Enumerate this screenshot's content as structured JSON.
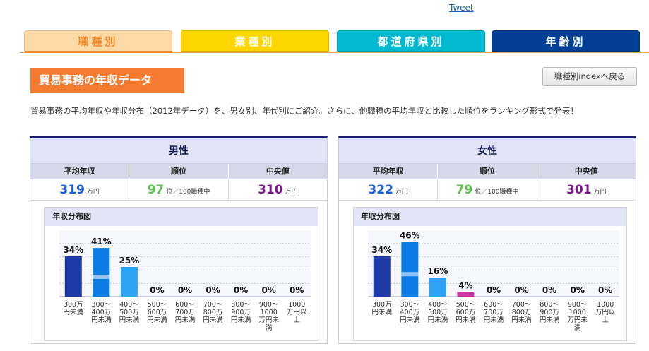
{
  "tweet": "Tweet",
  "tabs": {
    "job": "職種別",
    "industry": "業種別",
    "prefecture": "都道府県別",
    "age": "年齢別"
  },
  "heading": "貿易事務の年収データ",
  "index_button": "職種別indexへ戻る",
  "intro": "貿易事務の平均年収や年収分布（2012年データ）を、男女別、年代別にご紹介。さらに、他職種の平均年収と比較した順位をランキング形式で発表！",
  "stat_headers": {
    "average": "平均年収",
    "rank": "順位",
    "median": "中央値"
  },
  "male": {
    "title": "男性",
    "average": "319",
    "average_unit": "万円",
    "rank": "97",
    "rank_unit": "位／100職種中",
    "median": "310",
    "median_unit": "万円",
    "dist_title": "年収分布図"
  },
  "female": {
    "title": "女性",
    "average": "322",
    "average_unit": "万円",
    "rank": "79",
    "rank_unit": "位／100職種中",
    "median": "301",
    "median_unit": "万円",
    "dist_title": "年収分布図"
  },
  "chart_data": [
    {
      "type": "bar",
      "categories": [
        "300万\n円未満",
        "300〜\n400万\n円未満",
        "400〜\n500万\n円未満",
        "500〜\n600万\n円未満",
        "600〜\n700万\n円未満",
        "700〜\n800万\n円未満",
        "800〜\n900万\n円未満",
        "900〜\n1000\n万円未\n満",
        "1000\n万円以\n上"
      ],
      "values": [
        34,
        41,
        25,
        0,
        0,
        0,
        0,
        0,
        0
      ],
      "ylim": [
        0,
        50
      ],
      "grid": true,
      "colors": [
        "#1d3aa8",
        "#0d7de6",
        "#2fa3f3",
        "#c8359c"
      ]
    },
    {
      "type": "bar",
      "categories": [
        "300万\n円未満",
        "300〜\n400万\n円未満",
        "400〜\n500万\n円未満",
        "500〜\n600万\n円未満",
        "600〜\n700万\n円未満",
        "700〜\n800万\n円未満",
        "800〜\n900万\n円未満",
        "900〜\n1000\n万円未\n満",
        "1000\n万円以\n上"
      ],
      "values": [
        34,
        46,
        16,
        4,
        0,
        0,
        0,
        0,
        0
      ],
      "ylim": [
        0,
        50
      ],
      "grid": true,
      "colors": [
        "#1d3aa8",
        "#0d7de6",
        "#2fa3f3",
        "#c8359c"
      ]
    }
  ]
}
